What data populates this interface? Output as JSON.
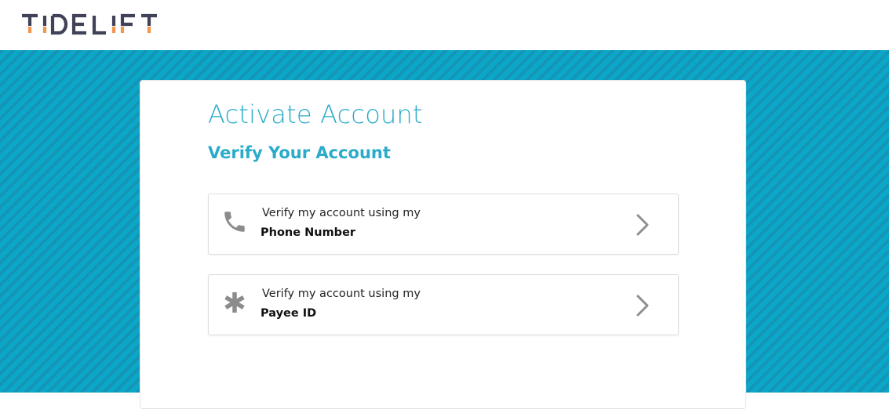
{
  "brand": {
    "name": "TIDELIFT",
    "logo_color": "#3f4258",
    "accent_color": "#f2954e"
  },
  "colors": {
    "banner": "#0ba7c9",
    "banner_stripe": "#1595b6",
    "title": "#29abc9"
  },
  "page": {
    "title": "Activate Account",
    "subtitle": "Verify Your Account"
  },
  "options": [
    {
      "icon": "phone-icon",
      "prefix": "Verify my account using my",
      "label": "Phone Number"
    },
    {
      "icon": "asterisk-icon",
      "prefix": "Verify my account using my",
      "label": "Payee ID"
    }
  ]
}
